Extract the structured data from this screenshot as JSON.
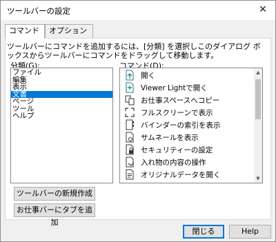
{
  "dialog": {
    "title": "ツールバーの設定",
    "close_symbol": "✕"
  },
  "tabs": [
    {
      "label": "コマンド",
      "active": true
    },
    {
      "label": "オプション",
      "active": false
    }
  ],
  "instruction": "ツールバーにコマンドを追加するには、[分類] を選択しこのダイアログ ボックスからツールバーにコマンドをドラッグして移動します。",
  "categories": {
    "label": "分類(G):",
    "items": [
      "ファイル",
      "編集",
      "表示",
      "文書",
      "ページ",
      "ツール",
      "ヘルプ"
    ],
    "selected": "文書"
  },
  "commands": {
    "label": "コマンド(D):",
    "items": [
      {
        "label": "開く",
        "icon": "open-document-icon"
      },
      {
        "label": "Viewer Lightで開く",
        "icon": "open-in-viewer-icon"
      },
      {
        "label": "お仕事スペースへコピー",
        "icon": "copy-to-workspace-icon"
      },
      {
        "label": "フルスクリーンで表示",
        "icon": "fullscreen-icon"
      },
      {
        "label": "バインダーの索引を表示",
        "icon": "binder-index-icon"
      },
      {
        "label": "サムネールを表示",
        "icon": "thumbnail-icon"
      },
      {
        "label": "セキュリティーの設定",
        "icon": "security-lock-icon"
      },
      {
        "label": "入れ物の内容の操作",
        "icon": "container-contents-icon"
      },
      {
        "label": "オリジナルデータを開く",
        "icon": "original-data-icon"
      }
    ]
  },
  "buttons": {
    "new_toolbar": "ツールバーの新規作成",
    "add_tab": "お仕事バーにタブを追加",
    "close": "閉じる",
    "help": "Help"
  }
}
